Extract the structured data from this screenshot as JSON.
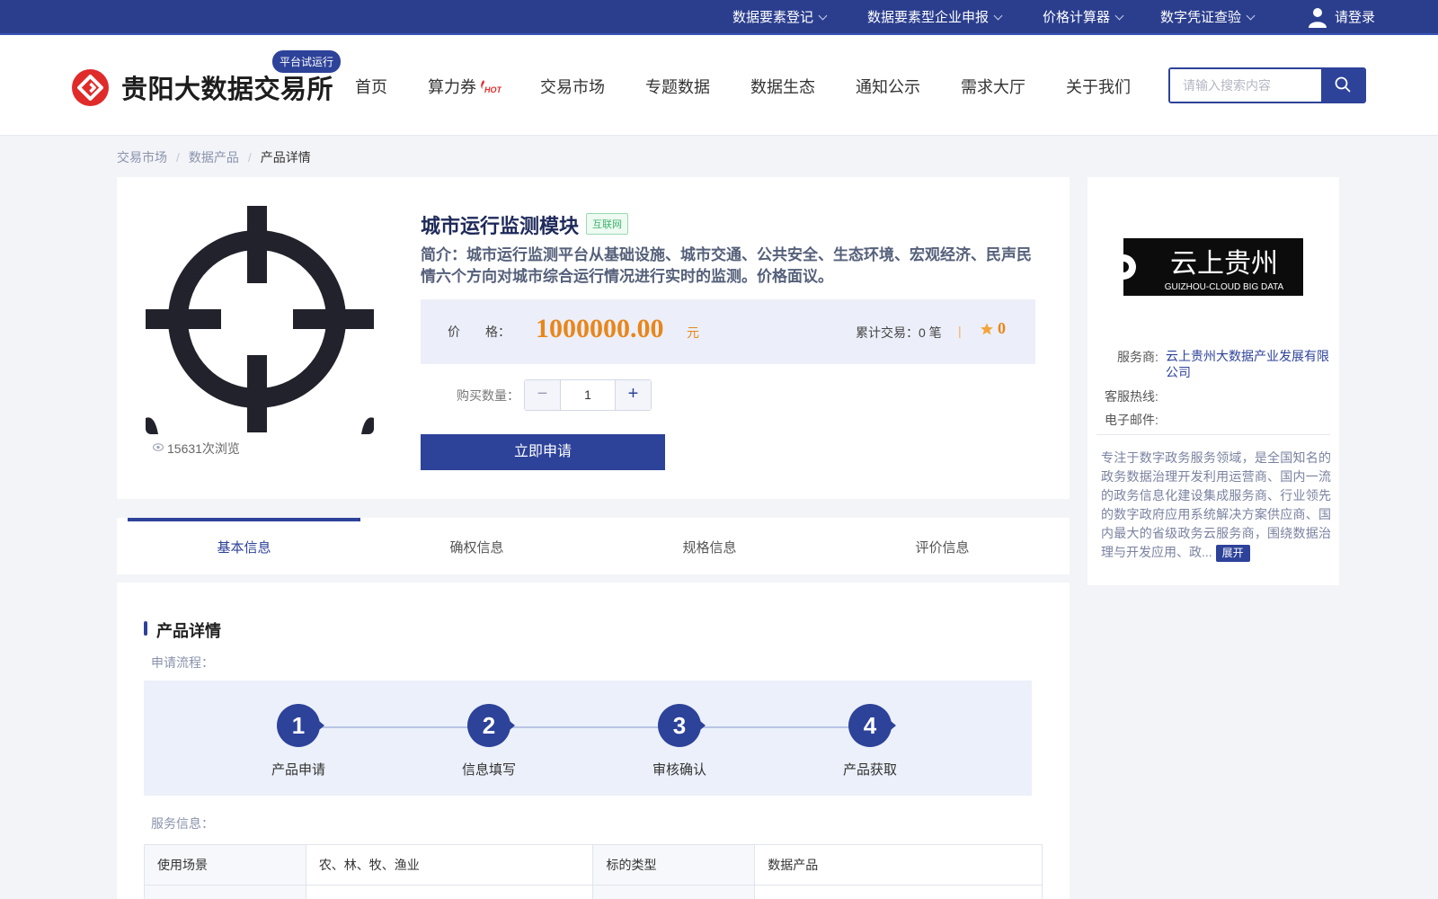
{
  "topbar": {
    "items": [
      {
        "label": "数据要素登记"
      },
      {
        "label": "数据要素型企业申报"
      },
      {
        "label": "价格计算器"
      },
      {
        "label": "数字凭证查验"
      }
    ],
    "login": "请登录"
  },
  "header": {
    "brand": "贵阳大数据交易所",
    "beta_badge": "平台试运行",
    "nav": [
      "首页",
      "算力券",
      "交易市场",
      "专题数据",
      "数据生态",
      "通知公示",
      "需求大厅",
      "关于我们"
    ],
    "hot_badge": "HOT",
    "search_placeholder": "请输入搜索内容"
  },
  "breadcrumb": [
    "交易市场",
    "数据产品",
    "产品详情"
  ],
  "product": {
    "title": "城市运行监测模块",
    "tag": "互联网",
    "intro": "简介：城市运行监测平台从基础设施、城市交通、公共安全、生态环境、宏观经济、民声民情六个方向对城市综合运行情况进行实时的监测。价格面议。",
    "views": "15631次浏览",
    "price_label": "价　　格：",
    "price": "1000000.00",
    "price_unit": "元",
    "trade_count": "累计交易：0 笔",
    "divider": "|",
    "rating": "0",
    "qty_label": "购买数量：",
    "qty": "1",
    "minus": "−",
    "plus": "+",
    "apply": "立即申请"
  },
  "provider": {
    "logo_cn": "云上贵州",
    "logo_en": "GUIZHOU-CLOUD BIG DATA",
    "service_label": "服务商:",
    "service_name": "云上贵州大数据产业发展有限公司",
    "hotline_label": "客服热线:",
    "email_label": "电子邮件:",
    "desc": "专注于数字政务服务领域，是全国知名的政务数据治理开发利用运营商、国内一流的政务信息化建设集成服务商、行业领先的数字政府应用系统解决方案供应商、国内最大的省级政务云服务商，围绕数据治理与开发应用、政...",
    "expand": "展开"
  },
  "tabs": [
    "基本信息",
    "确权信息",
    "规格信息",
    "评价信息"
  ],
  "details": {
    "section_title": "产品详情",
    "flow_label": "申请流程：",
    "steps": [
      {
        "num": "1",
        "label": "产品申请"
      },
      {
        "num": "2",
        "label": "信息填写"
      },
      {
        "num": "3",
        "label": "审核确认"
      },
      {
        "num": "4",
        "label": "产品获取"
      }
    ],
    "service_label": "服务信息：",
    "table": [
      {
        "k1": "使用场景",
        "v1": "农、林、牧、渔业",
        "k2": "标的类型",
        "v2": "数据产品"
      },
      {
        "k1": "",
        "v1": "",
        "k2": "",
        "v2": ""
      }
    ]
  },
  "colors": {
    "brand": "#2d4299",
    "accent": "#e8861b",
    "logo_red": "#e02b2b"
  }
}
